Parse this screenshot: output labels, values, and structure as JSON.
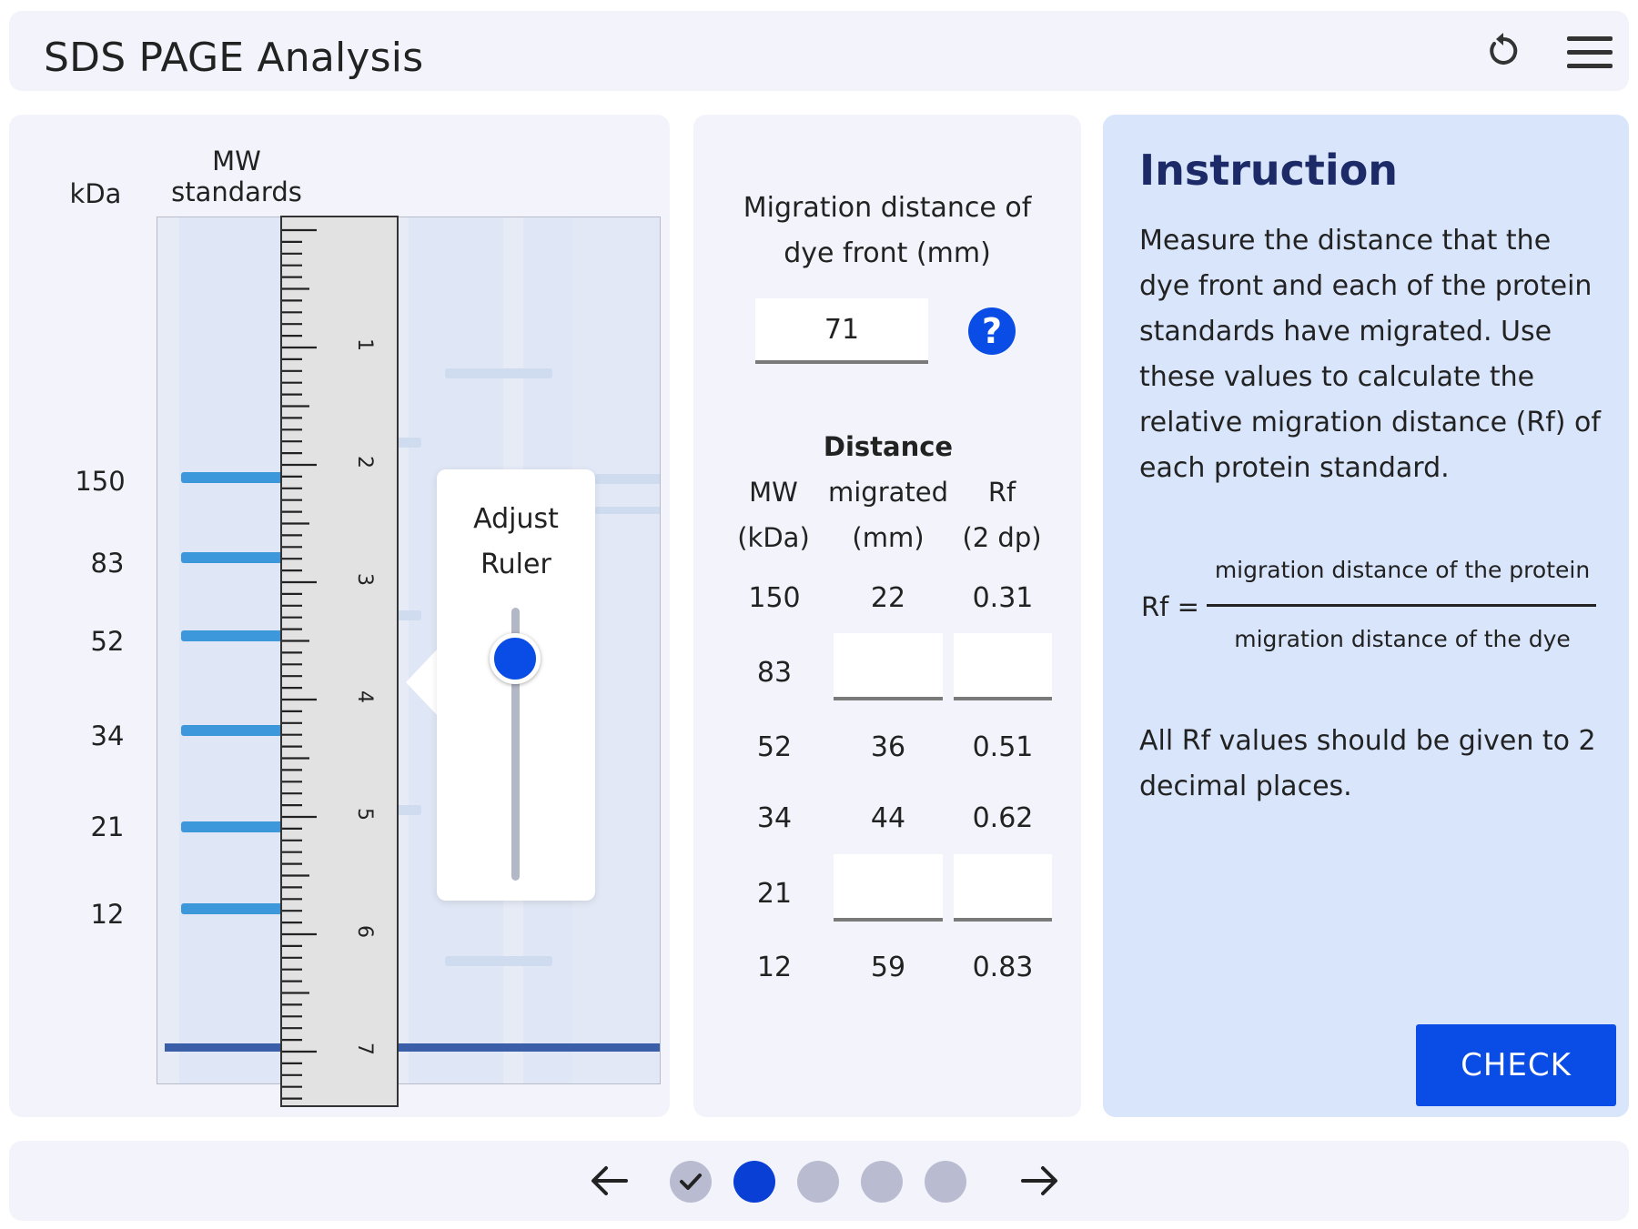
{
  "app": {
    "title": "SDS PAGE Analysis"
  },
  "header": {
    "reset_icon": "reset-icon",
    "menu_icon": "hamburger-menu-icon"
  },
  "gel": {
    "kda_label": "kDa",
    "mw_label": "MW\nstandards",
    "marker_labels": [
      "150",
      "83",
      "52",
      "34",
      "21",
      "12"
    ],
    "ruler_numbers": [
      "1",
      "2",
      "3",
      "4",
      "5",
      "6",
      "7"
    ],
    "band_color": "#3d97db",
    "dye_front_color": "#3a5ea8"
  },
  "adjust": {
    "title": "Adjust\nRuler"
  },
  "migration": {
    "label": "Migration distance of dye front (mm)",
    "value": "71",
    "help_label": "?"
  },
  "table": {
    "headers": {
      "mw": "MW\n(kDa)",
      "distance_top": "Distance",
      "distance": "migrated\n(mm)",
      "rf": "Rf\n(2 dp)"
    },
    "rows": [
      {
        "mw": "150",
        "distance": "22",
        "rf": "0.31",
        "editable": false
      },
      {
        "mw": "83",
        "distance": "",
        "rf": "",
        "editable": true
      },
      {
        "mw": "52",
        "distance": "36",
        "rf": "0.51",
        "editable": false
      },
      {
        "mw": "34",
        "distance": "44",
        "rf": "0.62",
        "editable": false
      },
      {
        "mw": "21",
        "distance": "",
        "rf": "",
        "editable": true
      },
      {
        "mw": "12",
        "distance": "59",
        "rf": "0.83",
        "editable": false
      }
    ]
  },
  "instruction": {
    "title": "Instruction",
    "body": "Measure the distance that the dye front and each of the protein standards have migrated. Use these values to calculate the relative migration distance (Rf) of each protein standard.",
    "formula_lhs": "Rf =",
    "formula_numerator": "migration distance of the protein",
    "formula_denominator": "migration distance of the dye",
    "note": "All Rf values should be given to 2 decimal places.",
    "check_label": "CHECK"
  },
  "footer": {
    "prev_icon": "arrow-left-icon",
    "next_icon": "arrow-right-icon",
    "steps": [
      "done",
      "current",
      "pending",
      "pending",
      "pending"
    ]
  },
  "colors": {
    "accent": "#0a4ce6",
    "instruction_bg": "#d8e5fb",
    "panel_bg": "#f3f4fb"
  }
}
